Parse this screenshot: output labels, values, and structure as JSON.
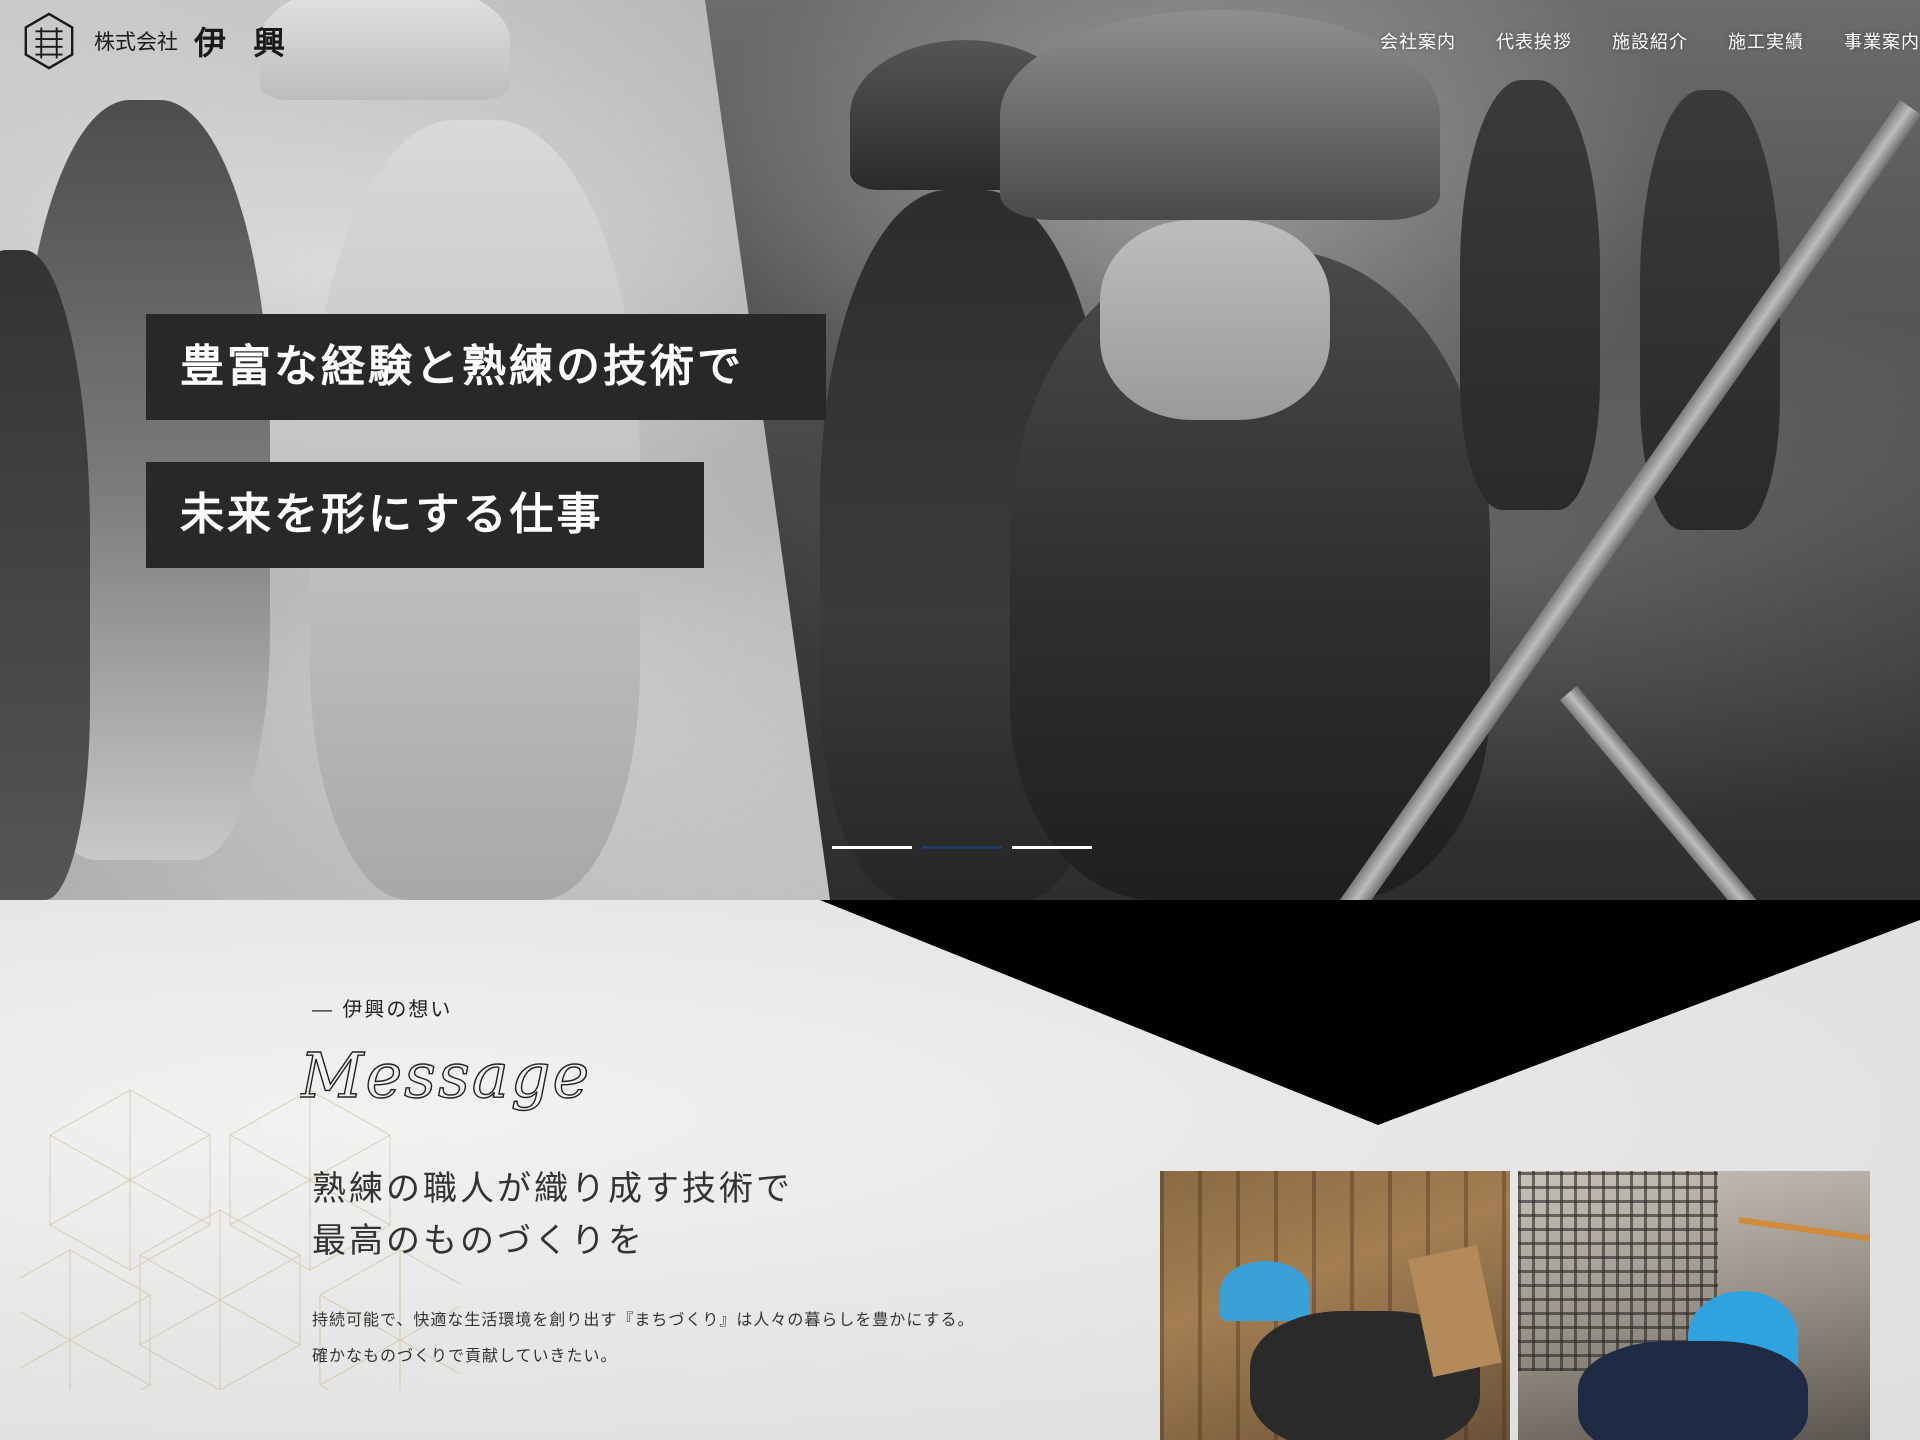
{
  "company": {
    "prefix": "株式会社",
    "name": "伊 興",
    "logo_icon": "building-emblem-icon"
  },
  "nav": {
    "items": [
      {
        "label": "会社案内"
      },
      {
        "label": "代表挨拶"
      },
      {
        "label": "施設紹介"
      },
      {
        "label": "施工実績"
      },
      {
        "label": "事業案内"
      }
    ]
  },
  "hero": {
    "catch_line1": "豊富な経験と熟練の技術で",
    "catch_line2": "未来を形にする仕事",
    "slides": {
      "count": 3,
      "active_index": 1
    }
  },
  "message": {
    "label": "― 伊興の想い",
    "script_title": "Message",
    "title_line1": "熟練の職人が織り成す技術で",
    "title_line2": "最高のものづくりを",
    "body_line1": "持続可能で、快適な生活環境を創り出す『まちづくり』は人々の暮らしを豊かにする。",
    "body_line2": "確かなものづくりで貢献していきたい。"
  },
  "colors": {
    "catch_bg": "#282828",
    "slide_active": "#1f3a63",
    "chevron": "#000000",
    "pattern_gold": "#c9b98a"
  }
}
